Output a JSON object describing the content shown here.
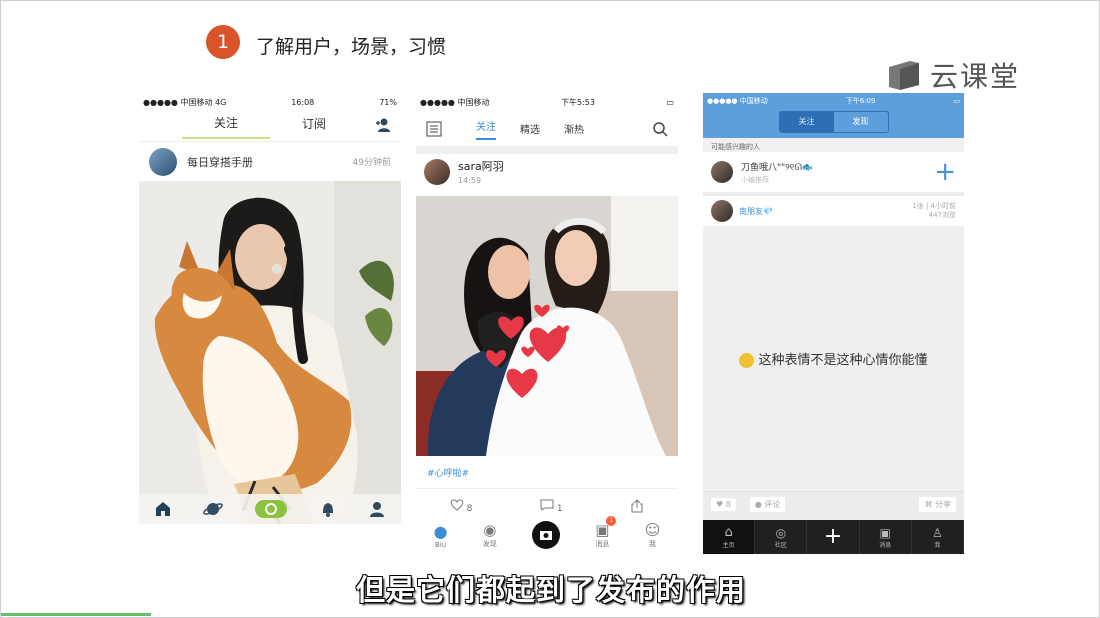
{
  "slide": {
    "step_number": "1",
    "title": "了解用户，场景，习惯",
    "brand": "云课堂",
    "subtitle": "但是它们都起到了发布的作用"
  },
  "phone1": {
    "status_carrier": "●●●●● 中国移动  4G",
    "status_time": "16:08",
    "status_battery": "71%",
    "tabs": [
      "关注",
      "订阅"
    ],
    "active_tab": "关注",
    "account_name": "每日穿搭手册",
    "time_ago": "49分钟前",
    "nav_icons": [
      "home-icon",
      "planet-icon",
      "camera-pill-icon",
      "bell-icon",
      "profile-icon"
    ]
  },
  "phone2": {
    "status_carrier": "●●●●● 中国移动",
    "status_time": "下午5:53",
    "tabs": [
      "关注",
      "精选",
      "渐热"
    ],
    "active_tab": "关注",
    "user_name": "sara阿羽",
    "post_time": "14:59",
    "tag": "#心呼啦#",
    "likes": "8",
    "comments": "1",
    "nav_labels": [
      "Biu",
      "发现",
      "",
      "消息",
      "我"
    ],
    "message_badge": "1"
  },
  "phone3": {
    "status_carrier": "●●●●● 中国移动",
    "status_time": "下午6:09",
    "segments": [
      "关注",
      "发现"
    ],
    "active_segment": "关注",
    "interest_heading": "可能感兴趣的人",
    "recommended_name": "刀鱼哦八\"\"୨୧ᘏ🐟",
    "recommended_subtitle": "小编推荐",
    "post_author": "南朋友💎",
    "post_meta_1": "1张 | 4小时前",
    "post_meta_2": "447浏览",
    "message": "这种表情不是这种心情你能懂",
    "likes": "8",
    "comment_label": "评论",
    "share_label": "分享",
    "nav_labels": [
      "主页",
      "社区",
      "",
      "消息",
      "我"
    ]
  },
  "colors": {
    "badge": "#d9542b",
    "phone1_accent": "#c8e08a",
    "phone2_accent": "#3a8fd6",
    "phone3_header": "#5d9fdb",
    "progress": "#67c16c"
  },
  "progress_fraction": 0.136
}
